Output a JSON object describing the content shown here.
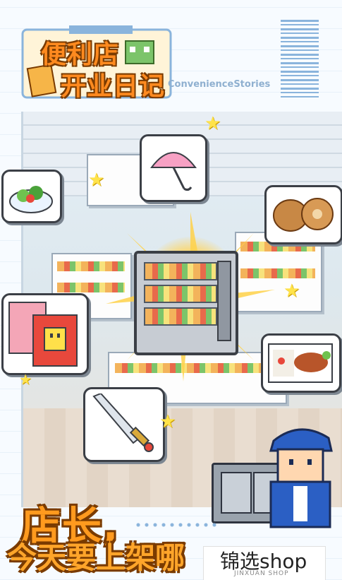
{
  "header": {
    "title_line1": "便利店",
    "title_line2": "开业日记",
    "subtitle": "ConvenienceStories"
  },
  "scene": {
    "bubbles": [
      {
        "name": "salad-bubble",
        "icon": "salad-icon"
      },
      {
        "name": "umbrella-bubble",
        "icon": "umbrella-icon"
      },
      {
        "name": "bread-bubble",
        "icon": "bread-icon"
      },
      {
        "name": "shirt-bubble",
        "icon": "shirt-icon"
      },
      {
        "name": "bento-bubble",
        "icon": "bento-icon"
      },
      {
        "name": "sword-bubble",
        "icon": "sword-icon"
      }
    ],
    "center_item": "fridge-icon"
  },
  "banner": {
    "line1": "店长,",
    "line2": "今天要上架哪"
  },
  "watermark": {
    "title": "锦选shop",
    "sub": "JINXUAN SHOP"
  },
  "colors": {
    "title_orange": "#ff8a1f",
    "outline_brown": "#7a3b00",
    "accent_blue": "#8ab4dc"
  }
}
